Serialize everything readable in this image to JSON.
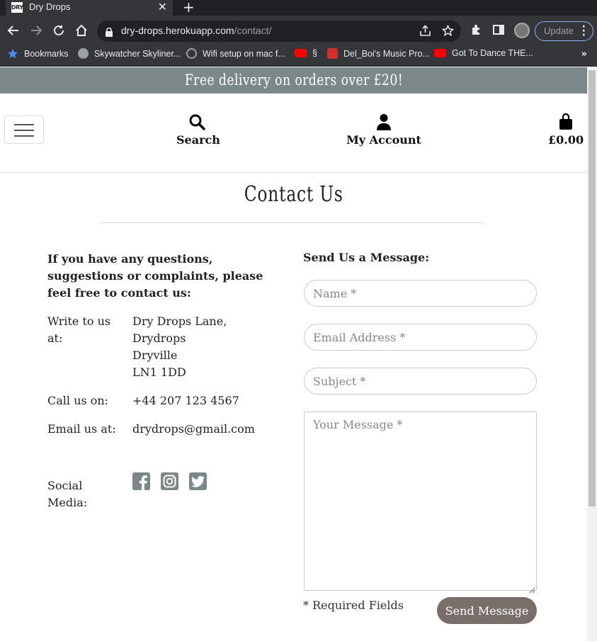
{
  "browser": {
    "tab_title": "Dry Drops",
    "tab_favicon_text": "DRY",
    "url_host": "dry-drops.herokuapp.com",
    "url_path": "/contact/",
    "update_label": "Update",
    "bookmarks": [
      {
        "label": "Bookmarks",
        "icon": "star-icon",
        "color": "#4a8df0"
      },
      {
        "label": "Skywatcher Skyliner...",
        "icon": "globe-icon",
        "color": "#9aa0a6"
      },
      {
        "label": "Wifi setup on mac f...",
        "icon": "planet-icon",
        "color": "#9aa0a6"
      },
      {
        "label": "§",
        "icon": "youtube-icon",
        "color": "#ff0000"
      },
      {
        "label": "Del_Boi's Music Pro...",
        "icon": "os-icon",
        "color": "#d32f2f"
      },
      {
        "label": "Got To Dance THE...",
        "icon": "youtube-icon",
        "color": "#ff0000"
      }
    ],
    "bookmarks_more": "»"
  },
  "site": {
    "promo": "Free delivery on orders over £20!",
    "nav": {
      "search_label": "Search",
      "account_label": "My Account",
      "bag_total": "£0.00"
    }
  },
  "contact": {
    "title": "Contact Us",
    "intro": "If you have any questions, suggestions or complaints, please feel free to contact us:",
    "write_label": "Write to us at:",
    "address_lines": [
      "Dry Drops Lane,",
      "Drydrops",
      "Dryville",
      "LN1 1DD"
    ],
    "call_label": "Call us on:",
    "phone": "+44 207 123 4567",
    "email_label": "Email us at:",
    "email": "drydrops@gmail.com",
    "social_label": "Social Media:",
    "social_icons": [
      "facebook-icon",
      "instagram-icon",
      "twitter-icon"
    ]
  },
  "form": {
    "title": "Send Us a Message:",
    "name_placeholder": "Name *",
    "email_placeholder": "Email Address *",
    "subject_placeholder": "Subject *",
    "message_placeholder": "Your Message *",
    "required_note": "* Required Fields",
    "send_label": "Send Message"
  },
  "colors": {
    "promo_bg": "#7c878a",
    "button_bg": "#7a6e6a",
    "social_bg": "#7c878a"
  }
}
